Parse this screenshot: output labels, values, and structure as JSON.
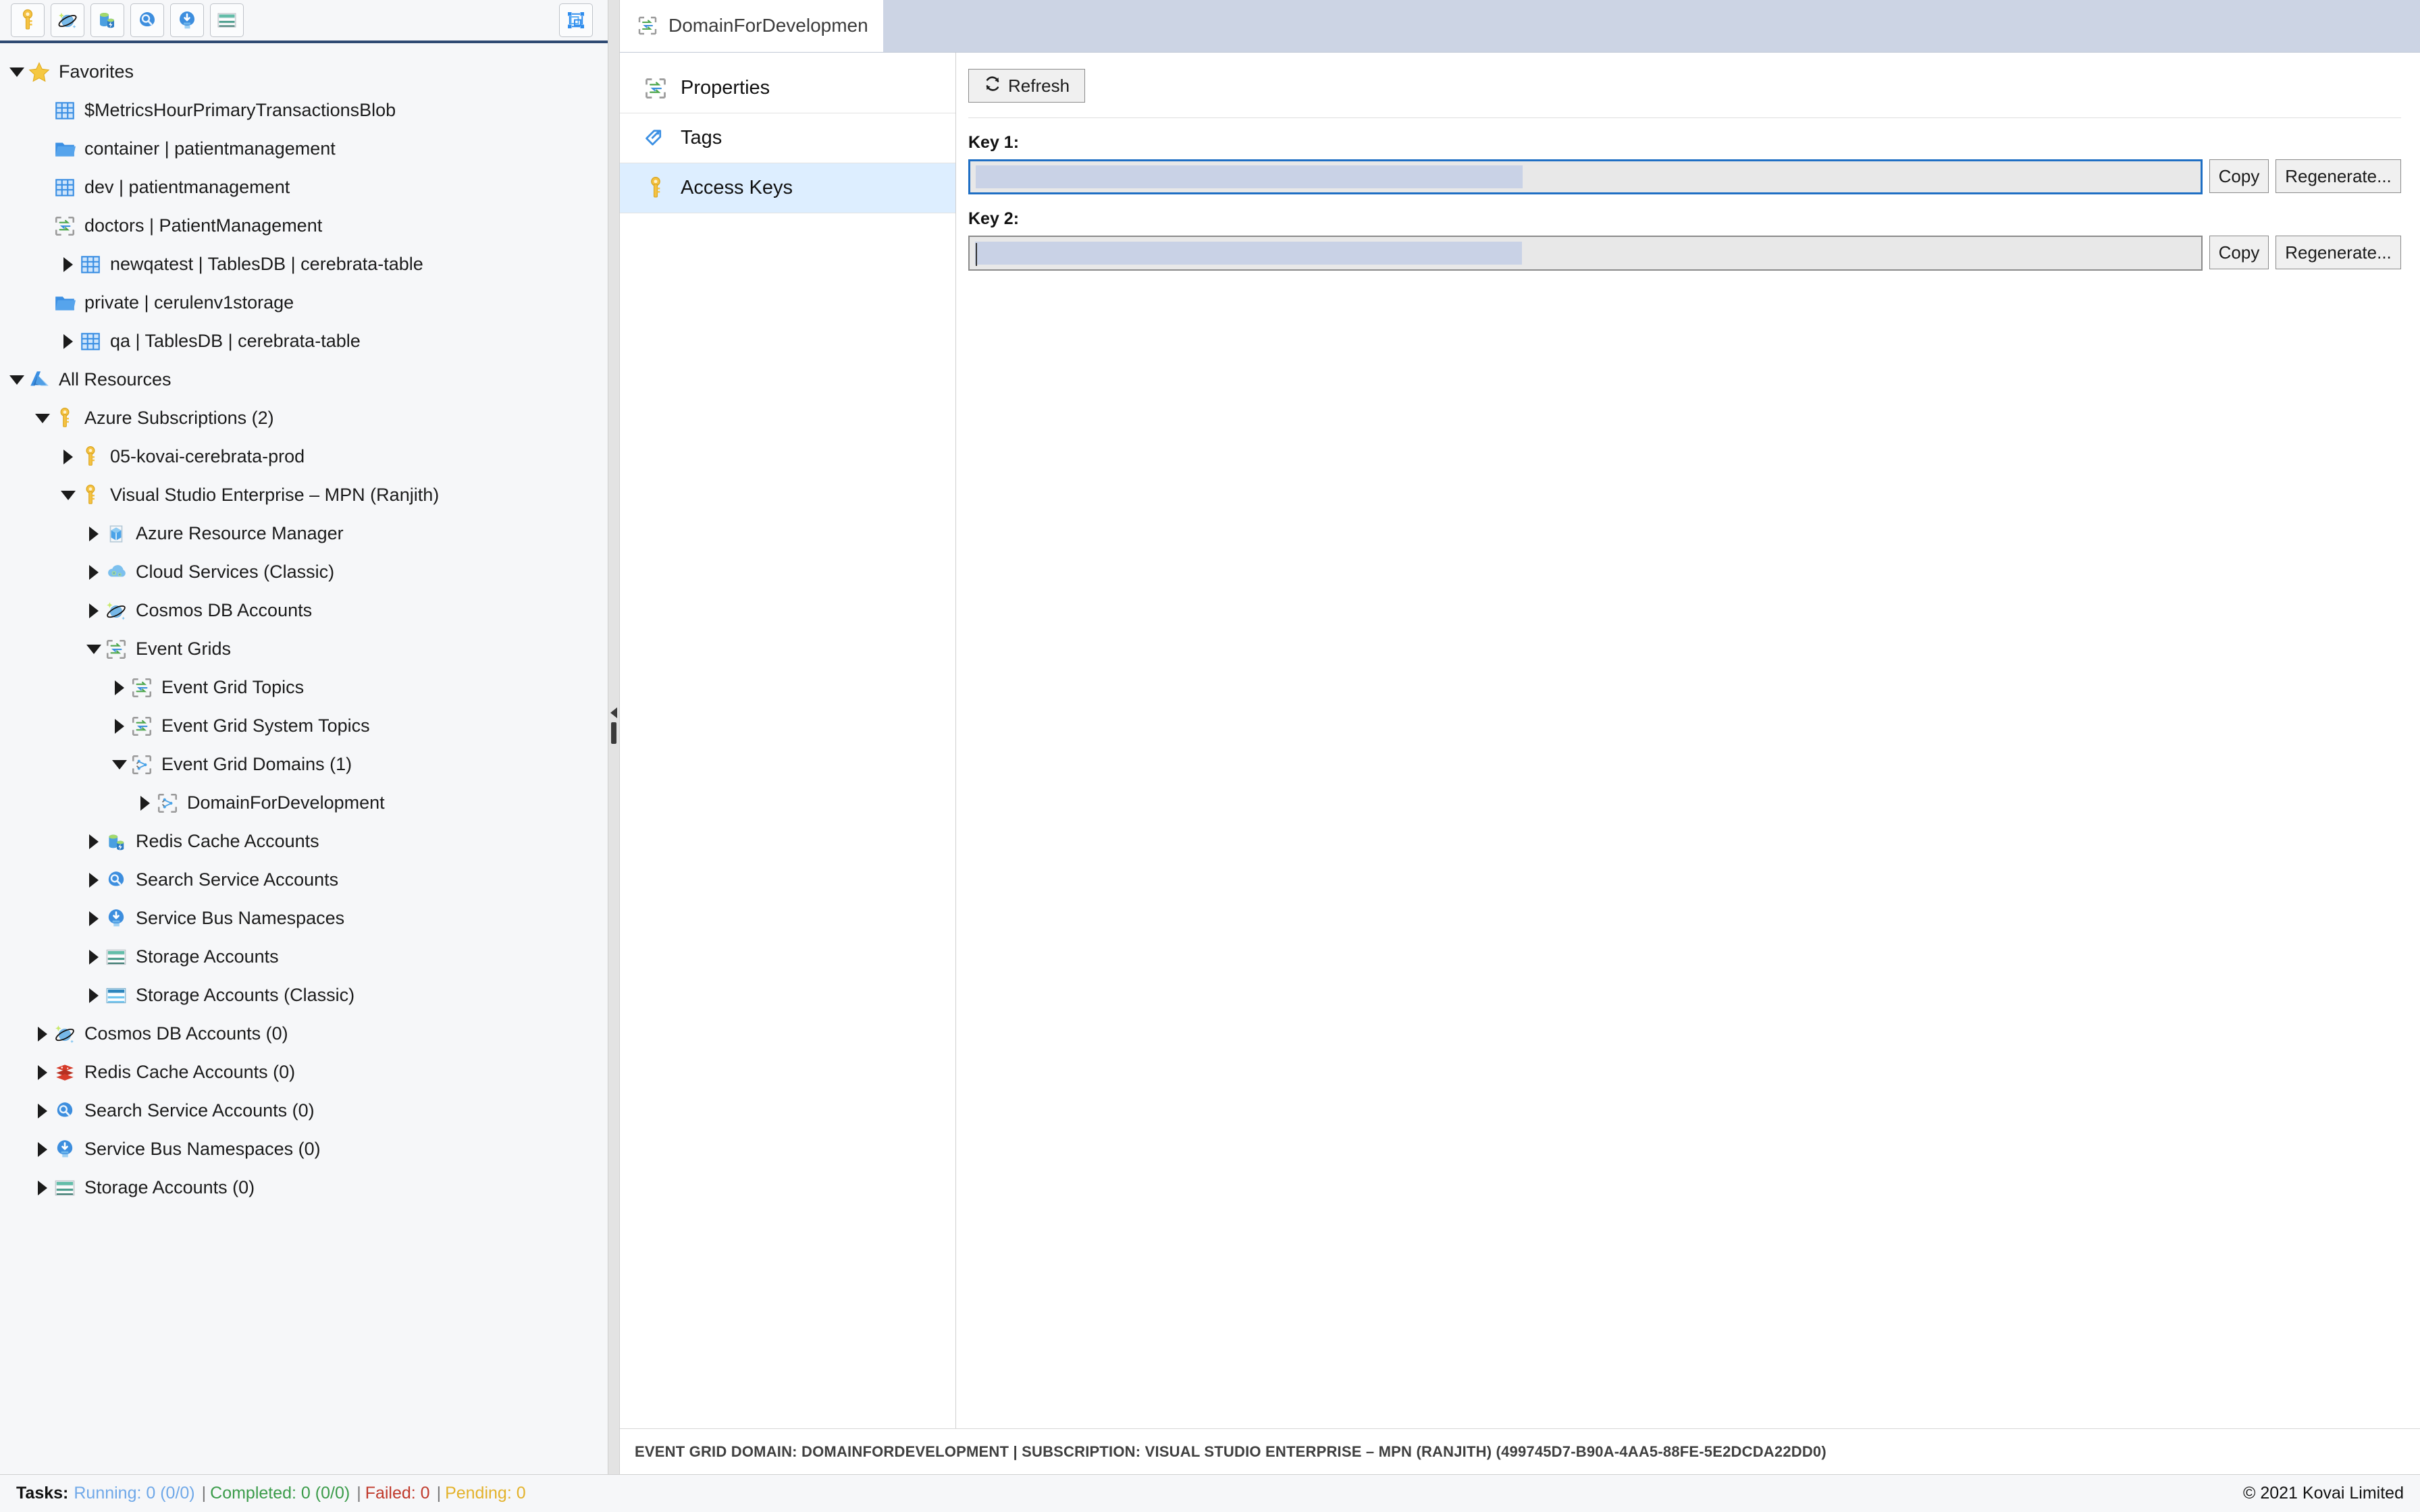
{
  "toolbar": {
    "buttons": [
      {
        "name": "access-keys-icon",
        "title": "Access Keys"
      },
      {
        "name": "cosmos-db-icon",
        "title": "Cosmos DB Accounts"
      },
      {
        "name": "redis-cache-icon",
        "title": "Redis Cache Accounts"
      },
      {
        "name": "search-service-icon",
        "title": "Search Service Accounts"
      },
      {
        "name": "service-bus-icon",
        "title": "Service Bus Namespaces"
      },
      {
        "name": "storage-account-icon",
        "title": "Storage Accounts"
      }
    ],
    "right_button": {
      "name": "collapse-all-icon",
      "title": "Collapse All"
    }
  },
  "tree": [
    {
      "label": "Favorites",
      "indent": 0,
      "twisty": "expanded",
      "icon": "star"
    },
    {
      "label": "$MetricsHourPrimaryTransactionsBlob",
      "indent": 1,
      "twisty": "none",
      "icon": "table"
    },
    {
      "label": "container | patientmanagement",
      "indent": 1,
      "twisty": "none",
      "icon": "folder"
    },
    {
      "label": "dev | patientmanagement",
      "indent": 1,
      "twisty": "none",
      "icon": "table"
    },
    {
      "label": "doctors | PatientManagement",
      "indent": 1,
      "twisty": "none",
      "icon": "eventgrid"
    },
    {
      "label": "newqatest | TablesDB | cerebrata-table",
      "indent": 2,
      "twisty": "collapsed",
      "icon": "table"
    },
    {
      "label": "private | cerulenv1storage",
      "indent": 1,
      "twisty": "none",
      "icon": "folder"
    },
    {
      "label": "qa | TablesDB | cerebrata-table",
      "indent": 2,
      "twisty": "collapsed",
      "icon": "table"
    },
    {
      "label": "All Resources",
      "indent": 0,
      "twisty": "expanded",
      "icon": "azure"
    },
    {
      "label": "Azure Subscriptions (2)",
      "indent": 1,
      "twisty": "expanded",
      "icon": "key"
    },
    {
      "label": "05-kovai-cerebrata-prod",
      "indent": 2,
      "twisty": "collapsed",
      "icon": "key"
    },
    {
      "label": "Visual Studio Enterprise – MPN (Ranjith)",
      "indent": 2,
      "twisty": "expanded",
      "icon": "key"
    },
    {
      "label": "Azure Resource Manager",
      "indent": 3,
      "twisty": "collapsed",
      "icon": "arm"
    },
    {
      "label": "Cloud Services (Classic)",
      "indent": 3,
      "twisty": "collapsed",
      "icon": "cloudservice"
    },
    {
      "label": "Cosmos DB Accounts",
      "indent": 3,
      "twisty": "collapsed",
      "icon": "cosmos"
    },
    {
      "label": "Event Grids",
      "indent": 3,
      "twisty": "expanded",
      "icon": "eventgrid"
    },
    {
      "label": "Event Grid Topics",
      "indent": 4,
      "twisty": "collapsed",
      "icon": "eventgrid"
    },
    {
      "label": "Event Grid System Topics",
      "indent": 4,
      "twisty": "collapsed",
      "icon": "eventgrid"
    },
    {
      "label": "Event Grid Domains (1)",
      "indent": 4,
      "twisty": "expanded",
      "icon": "eventgriddomain"
    },
    {
      "label": "DomainForDevelopment",
      "indent": 5,
      "twisty": "collapsed",
      "icon": "eventgriddomain"
    },
    {
      "label": "Redis Cache Accounts",
      "indent": 3,
      "twisty": "collapsed",
      "icon": "redis3d"
    },
    {
      "label": "Search Service Accounts",
      "indent": 3,
      "twisty": "collapsed",
      "icon": "search"
    },
    {
      "label": "Service Bus Namespaces",
      "indent": 3,
      "twisty": "collapsed",
      "icon": "servicebus"
    },
    {
      "label": "Storage Accounts",
      "indent": 3,
      "twisty": "collapsed",
      "icon": "storage"
    },
    {
      "label": "Storage Accounts (Classic)",
      "indent": 3,
      "twisty": "collapsed",
      "icon": "storageclassic"
    },
    {
      "label": "Cosmos DB Accounts (0)",
      "indent": 1,
      "twisty": "collapsed",
      "icon": "cosmos"
    },
    {
      "label": "Redis Cache Accounts (0)",
      "indent": 1,
      "twisty": "collapsed",
      "icon": "redis"
    },
    {
      "label": "Search Service Accounts (0)",
      "indent": 1,
      "twisty": "collapsed",
      "icon": "search"
    },
    {
      "label": "Service Bus Namespaces (0)",
      "indent": 1,
      "twisty": "collapsed",
      "icon": "servicebus"
    },
    {
      "label": "Storage Accounts (0)",
      "indent": 1,
      "twisty": "collapsed",
      "icon": "storage"
    }
  ],
  "tab": {
    "title": "DomainForDevelopment Vi",
    "icon": "eventgrid-icon"
  },
  "nav": [
    {
      "label": "Properties",
      "icon": "eventgrid-icon",
      "selected": false
    },
    {
      "label": "Tags",
      "icon": "tags-icon",
      "selected": false
    },
    {
      "label": "Access Keys",
      "icon": "key-icon",
      "selected": true
    }
  ],
  "detail": {
    "refresh_label": "Refresh",
    "key1_label": "Key 1:",
    "key1_value": "",
    "key2_label": "Key 2:",
    "key2_value": "",
    "copy_label": "Copy",
    "regenerate_label": "Regenerate..."
  },
  "context_bar": {
    "text": "EVENT GRID DOMAIN: DOMAINFORDEVELOPMENT | SUBSCRIPTION: VISUAL STUDIO ENTERPRISE – MPN (RANJITH) (499745D7-B90A-4AA5-88FE-5E2DCDA22DD0)"
  },
  "footer": {
    "tasks_label": "Tasks:",
    "running": "Running: 0 (0/0)",
    "completed": "Completed: 0 (0/0)",
    "failed": "Failed: 0",
    "pending": "Pending: 0",
    "separator": "|",
    "copyright": "© 2021 Kovai Limited",
    "colors": {
      "running": "#6fa8e8",
      "completed": "#3a9b49",
      "failed": "#c0392b",
      "pending": "#e3b22b"
    }
  }
}
